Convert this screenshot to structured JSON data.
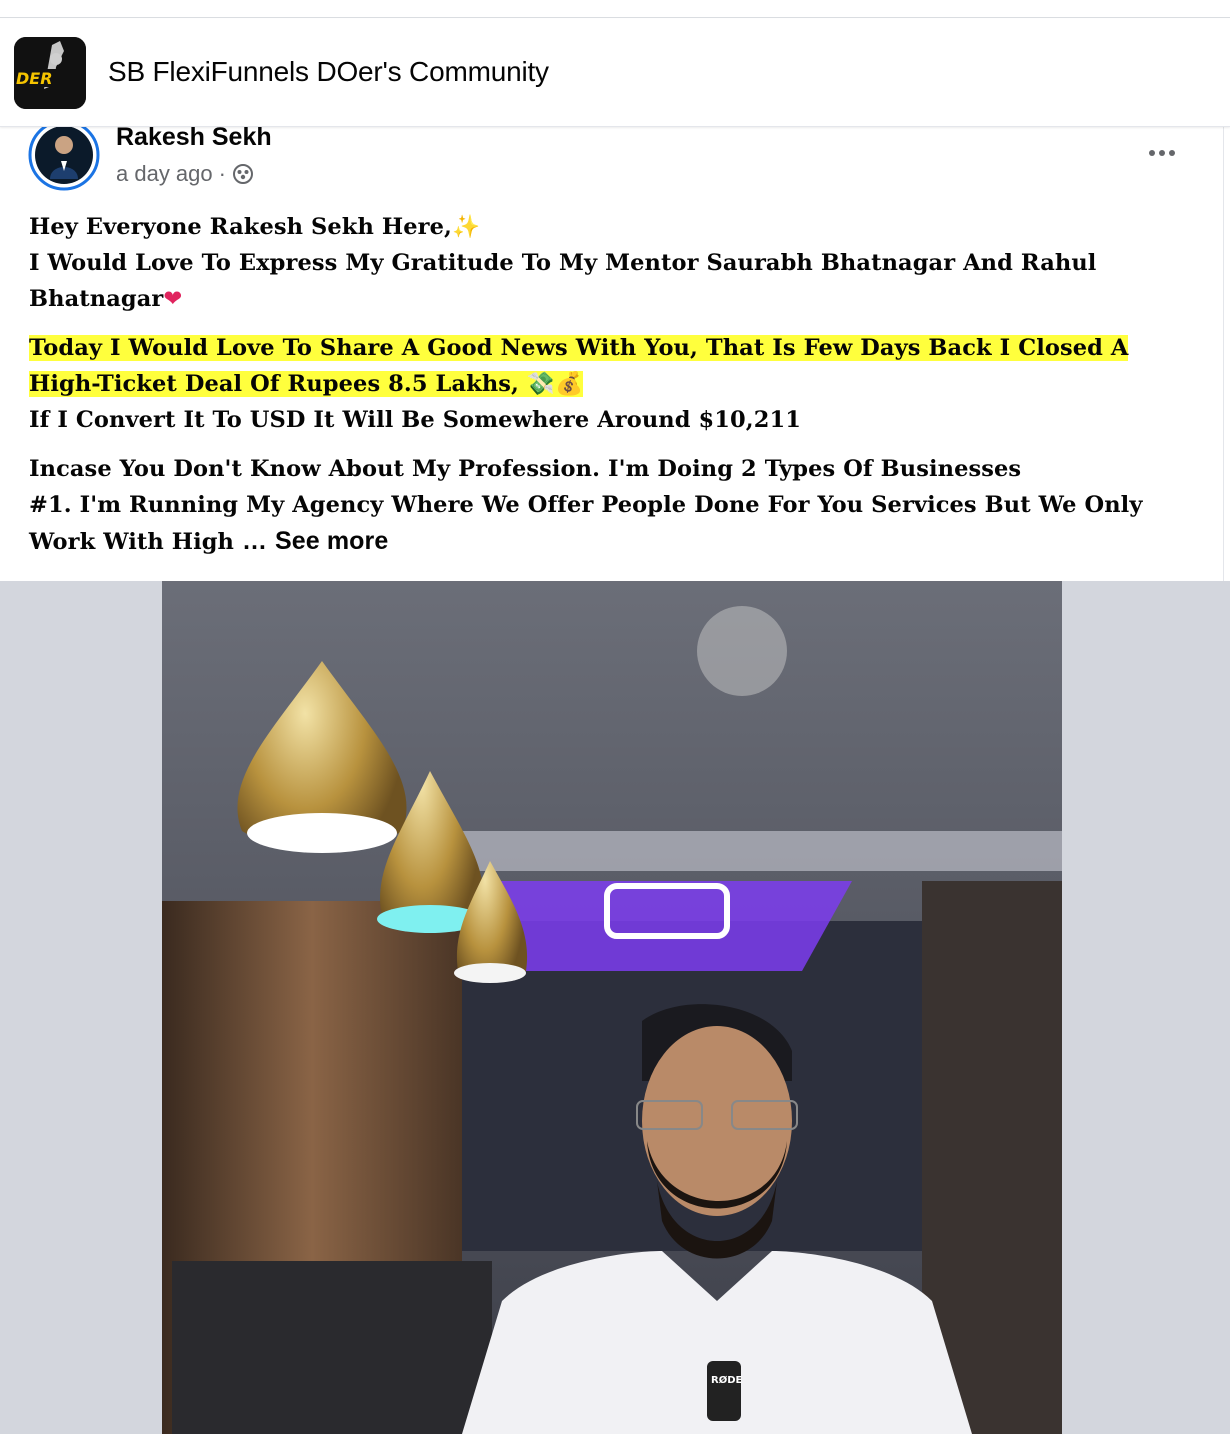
{
  "group": {
    "name": "SB FlexiFunnels DOer's Community",
    "avatar_text": "DER"
  },
  "post": {
    "author": "Rakesh Sekh",
    "time": "a day ago",
    "separator": "·",
    "privacy_icon": "group-audience-icon",
    "lines": {
      "p1_l1": "Hey Everyone Rakesh Sekh Here,",
      "p1_l1_emoji": "✨",
      "p1_l2": "I Would Love To Express My Gratitude To My Mentor Saurabh Bhatnagar And Rahul Bhatnagar",
      "p1_l2_emoji": "❤",
      "p2_l1": "Today I Would Love To Share A Good News With You, That Is Few Days Back I Closed A High-Ticket Deal Of Rupees 8.5 Lakhs,",
      "p2_l1_emoji": "💸💰",
      "p2_l2": "If I Convert It To USD It Will Be Somewhere Around $10,211",
      "p3_l1": "Incase You Don't Know About My Profession. I'm Doing 2 Types Of Businesses",
      "p3_l2": "#1. I'm Running My Agency Where We Offer People Done For You Services But We Only Work With High",
      "ellipsis": "…",
      "see_more": "See more"
    },
    "highlight_color": "#ffff3d",
    "photo_badge": "RØDE"
  }
}
